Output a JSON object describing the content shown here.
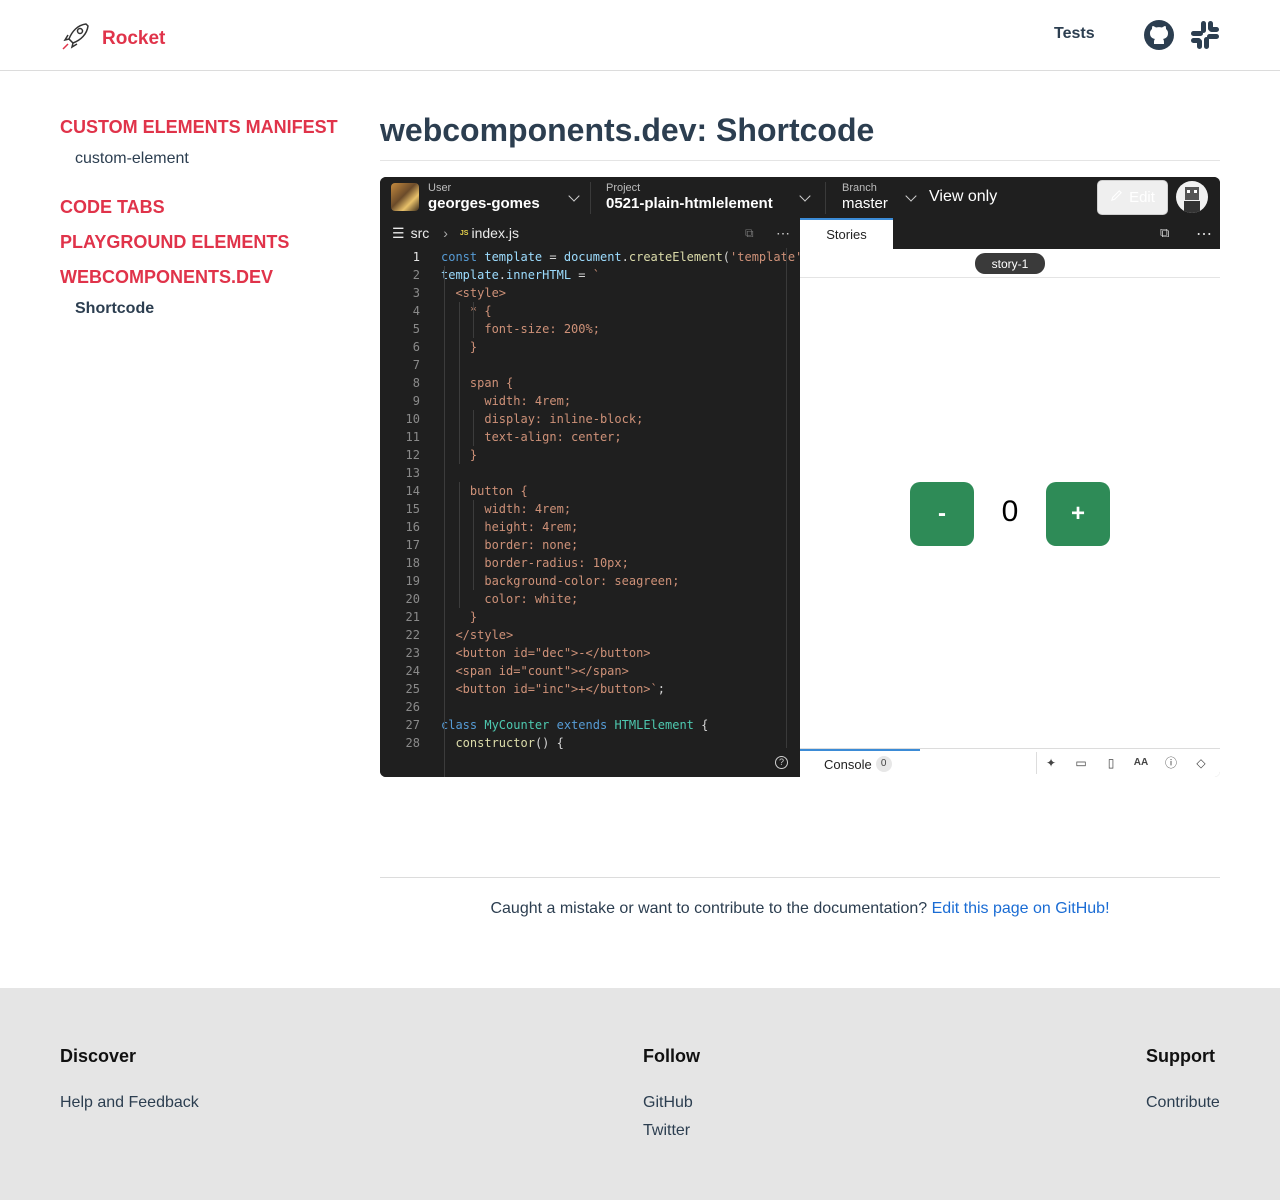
{
  "header": {
    "brand": "Rocket",
    "nav_tests": "Tests"
  },
  "sidebar": {
    "sections": [
      {
        "heading": "CUSTOM ELEMENTS MANIFEST",
        "items": [
          "custom-element"
        ]
      },
      {
        "heading": "CODE TABS",
        "items": []
      },
      {
        "heading": "PLAYGROUND ELEMENTS",
        "items": []
      },
      {
        "heading": "WEBCOMPONENTS.DEV",
        "items": [
          "Shortcode"
        ]
      }
    ]
  },
  "main": {
    "title": "webcomponents.dev: Shortcode"
  },
  "ide": {
    "user_label": "User",
    "user_value": "georges-gomes",
    "project_label": "Project",
    "project_value": "0521-plain-htmlelement",
    "branch_label": "Branch",
    "branch_value": "master",
    "view_only": "View only",
    "edit_label": "Edit",
    "folder": "src",
    "file": "index.js",
    "file_badge": "JS",
    "stories_tab": "Stories",
    "story_chip": "story-1",
    "counter_dec": "-",
    "counter_value": "0",
    "counter_inc": "+",
    "console_tab": "Console",
    "console_count": "0",
    "help": "?"
  },
  "code_lines": [
    "const template = document.createElement('template'",
    "template.innerHTML = `",
    "  <style>",
    "    * {",
    "      font-size: 200%;",
    "    }",
    "",
    "    span {",
    "      width: 4rem;",
    "      display: inline-block;",
    "      text-align: center;",
    "    }",
    "",
    "    button {",
    "      width: 4rem;",
    "      height: 4rem;",
    "      border: none;",
    "      border-radius: 10px;",
    "      background-color: seagreen;",
    "      color: white;",
    "    }",
    "  </style>",
    "  <button id=\"dec\">-</button>",
    "  <span id=\"count\"></span>",
    "  <button id=\"inc\">+</button>`;",
    "",
    "class MyCounter extends HTMLElement {",
    "  constructor() {"
  ],
  "edit_note": {
    "text": "Caught a mistake or want to contribute to the documentation?",
    "link": "Edit this page on GitHub!"
  },
  "footer": {
    "discover": {
      "heading": "Discover",
      "links": [
        "Help and Feedback"
      ]
    },
    "follow": {
      "heading": "Follow",
      "links": [
        "GitHub",
        "Twitter"
      ]
    },
    "support": {
      "heading": "Support",
      "links": [
        "Contribute"
      ]
    }
  },
  "colors": {
    "brand": "#e0334a",
    "button_green": "#2e8b57",
    "link_blue": "#1a6cd4"
  }
}
